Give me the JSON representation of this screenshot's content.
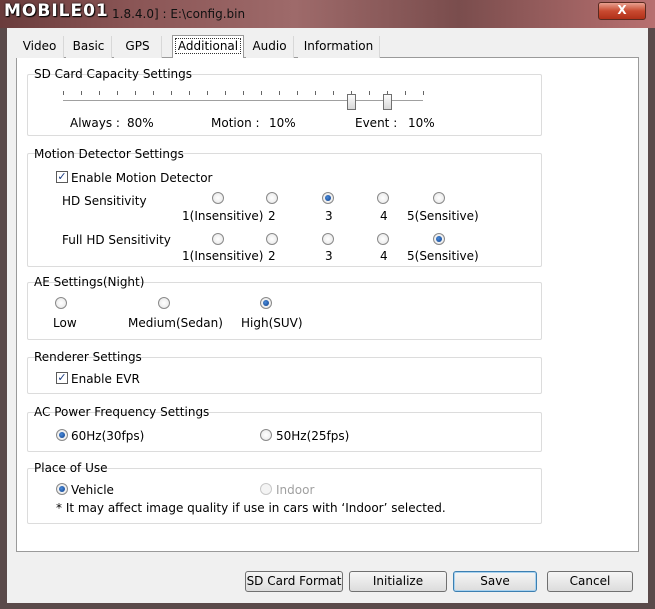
{
  "window": {
    "watermark": "MOBILE01",
    "title": "1.8.4.0] : E:\\config.bin",
    "close": "X"
  },
  "tabs": [
    "Video",
    "Basic",
    "GPS",
    "Additional",
    "Audio",
    "Information"
  ],
  "sd_card": {
    "title": "SD Card Capacity Settings",
    "always_label": "Always :",
    "always_value": "80%",
    "motion_label": "Motion :",
    "motion_value": "10%",
    "event_label": "Event :",
    "event_value": "10%",
    "thumb1_fraction": 0.8,
    "thumb2_fraction": 0.9
  },
  "motion": {
    "title": "Motion Detector Settings",
    "enable_label": "Enable Motion Detector",
    "enable_checked": true,
    "hd_label": "HD Sensitivity",
    "fullhd_label": "Full HD Sensitivity",
    "options": [
      "1(Insensitive)",
      "2",
      "3",
      "4",
      "5(Sensitive)"
    ],
    "hd_selected": "3",
    "fullhd_selected": "5(Sensitive)"
  },
  "ae": {
    "title": "AE Settings(Night)",
    "options": [
      "Low",
      "Medium(Sedan)",
      "High(SUV)"
    ],
    "selected": "High(SUV)"
  },
  "renderer": {
    "title": "Renderer Settings",
    "evr_label": "Enable EVR",
    "evr_checked": true
  },
  "ac": {
    "title": "AC Power Frequency Settings",
    "opt1": "60Hz(30fps)",
    "opt2": "50Hz(25fps)",
    "selected": "60Hz(30fps)"
  },
  "place": {
    "title": "Place of Use",
    "opt1": "Vehicle",
    "opt2": "Indoor",
    "selected": "Vehicle",
    "note": "* It may affect image quality if use in cars with ‘Indoor’ selected."
  },
  "buttons": {
    "sd_format": "SD Card Format",
    "initialize": "Initialize",
    "save": "Save",
    "cancel": "Cancel"
  }
}
